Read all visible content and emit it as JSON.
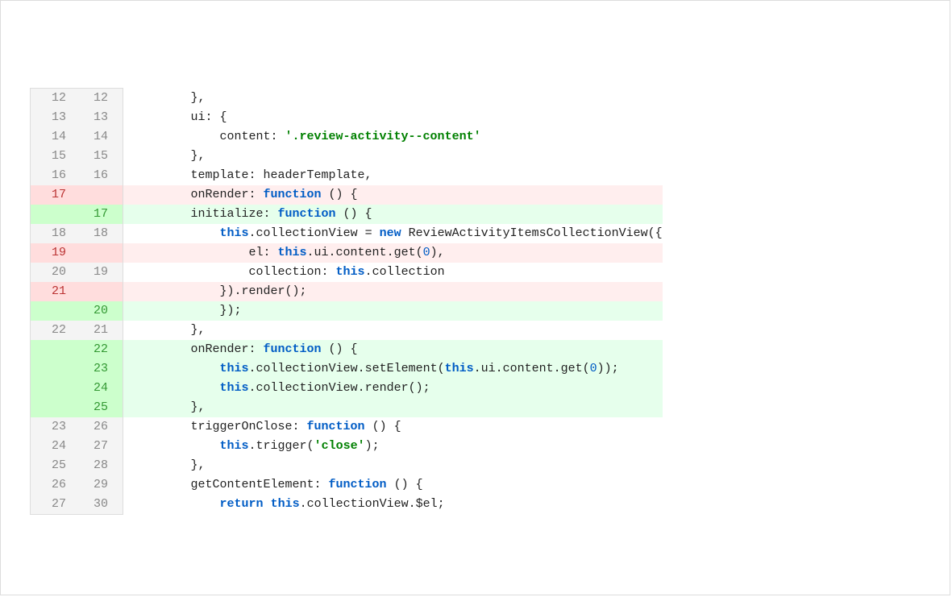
{
  "diff": {
    "lines": [
      {
        "type": "ctx",
        "old": "12",
        "new": "12",
        "tokens": [
          {
            "t": "        },"
          }
        ]
      },
      {
        "type": "ctx",
        "old": "13",
        "new": "13",
        "tokens": [
          {
            "t": "        ui: {"
          }
        ]
      },
      {
        "type": "ctx",
        "old": "14",
        "new": "14",
        "tokens": [
          {
            "t": "            content: "
          },
          {
            "t": "'.review-activity--content'",
            "c": "str"
          }
        ]
      },
      {
        "type": "ctx",
        "old": "15",
        "new": "15",
        "tokens": [
          {
            "t": "        },"
          }
        ]
      },
      {
        "type": "ctx",
        "old": "16",
        "new": "16",
        "tokens": [
          {
            "t": "        template: headerTemplate,"
          }
        ]
      },
      {
        "type": "del",
        "old": "17",
        "new": "",
        "tokens": [
          {
            "t": "        onRender: "
          },
          {
            "t": "function",
            "c": "kw"
          },
          {
            "t": " () {"
          }
        ]
      },
      {
        "type": "add",
        "old": "",
        "new": "17",
        "tokens": [
          {
            "t": "        initialize: "
          },
          {
            "t": "function",
            "c": "kw"
          },
          {
            "t": " () {"
          }
        ]
      },
      {
        "type": "ctx",
        "old": "18",
        "new": "18",
        "tokens": [
          {
            "t": "            "
          },
          {
            "t": "this",
            "c": "this"
          },
          {
            "t": ".collectionView = "
          },
          {
            "t": "new",
            "c": "kw"
          },
          {
            "t": " ReviewActivityItemsCollectionView({"
          }
        ]
      },
      {
        "type": "del",
        "old": "19",
        "new": "",
        "tokens": [
          {
            "t": "                el: "
          },
          {
            "t": "this",
            "c": "this"
          },
          {
            "t": ".ui.content.get("
          },
          {
            "t": "0",
            "c": "num"
          },
          {
            "t": "),"
          }
        ]
      },
      {
        "type": "ctx",
        "old": "20",
        "new": "19",
        "tokens": [
          {
            "t": "                collection: "
          },
          {
            "t": "this",
            "c": "this"
          },
          {
            "t": ".collection"
          }
        ]
      },
      {
        "type": "del",
        "old": "21",
        "new": "",
        "tokens": [
          {
            "t": "            }).render();"
          }
        ]
      },
      {
        "type": "add",
        "old": "",
        "new": "20",
        "tokens": [
          {
            "t": "            });"
          }
        ]
      },
      {
        "type": "ctx",
        "old": "22",
        "new": "21",
        "tokens": [
          {
            "t": "        },"
          }
        ]
      },
      {
        "type": "add",
        "old": "",
        "new": "22",
        "tokens": [
          {
            "t": "        onRender: "
          },
          {
            "t": "function",
            "c": "kw"
          },
          {
            "t": " () {"
          }
        ]
      },
      {
        "type": "add",
        "old": "",
        "new": "23",
        "tokens": [
          {
            "t": "            "
          },
          {
            "t": "this",
            "c": "this"
          },
          {
            "t": ".collectionView.setElement("
          },
          {
            "t": "this",
            "c": "this"
          },
          {
            "t": ".ui.content.get("
          },
          {
            "t": "0",
            "c": "num"
          },
          {
            "t": "));"
          }
        ]
      },
      {
        "type": "add",
        "old": "",
        "new": "24",
        "tokens": [
          {
            "t": "            "
          },
          {
            "t": "this",
            "c": "this"
          },
          {
            "t": ".collectionView.render();"
          }
        ]
      },
      {
        "type": "add",
        "old": "",
        "new": "25",
        "tokens": [
          {
            "t": "        },"
          }
        ]
      },
      {
        "type": "ctx",
        "old": "23",
        "new": "26",
        "tokens": [
          {
            "t": "        triggerOnClose: "
          },
          {
            "t": "function",
            "c": "kw"
          },
          {
            "t": " () {"
          }
        ]
      },
      {
        "type": "ctx",
        "old": "24",
        "new": "27",
        "tokens": [
          {
            "t": "            "
          },
          {
            "t": "this",
            "c": "this"
          },
          {
            "t": ".trigger("
          },
          {
            "t": "'close'",
            "c": "str"
          },
          {
            "t": ");"
          }
        ]
      },
      {
        "type": "ctx",
        "old": "25",
        "new": "28",
        "tokens": [
          {
            "t": "        },"
          }
        ]
      },
      {
        "type": "ctx",
        "old": "26",
        "new": "29",
        "tokens": [
          {
            "t": "        getContentElement: "
          },
          {
            "t": "function",
            "c": "kw"
          },
          {
            "t": " () {"
          }
        ]
      },
      {
        "type": "ctx",
        "old": "27",
        "new": "30",
        "tokens": [
          {
            "t": "            "
          },
          {
            "t": "return",
            "c": "kw"
          },
          {
            "t": " "
          },
          {
            "t": "this",
            "c": "this"
          },
          {
            "t": ".collectionView.$el;"
          }
        ]
      }
    ]
  }
}
